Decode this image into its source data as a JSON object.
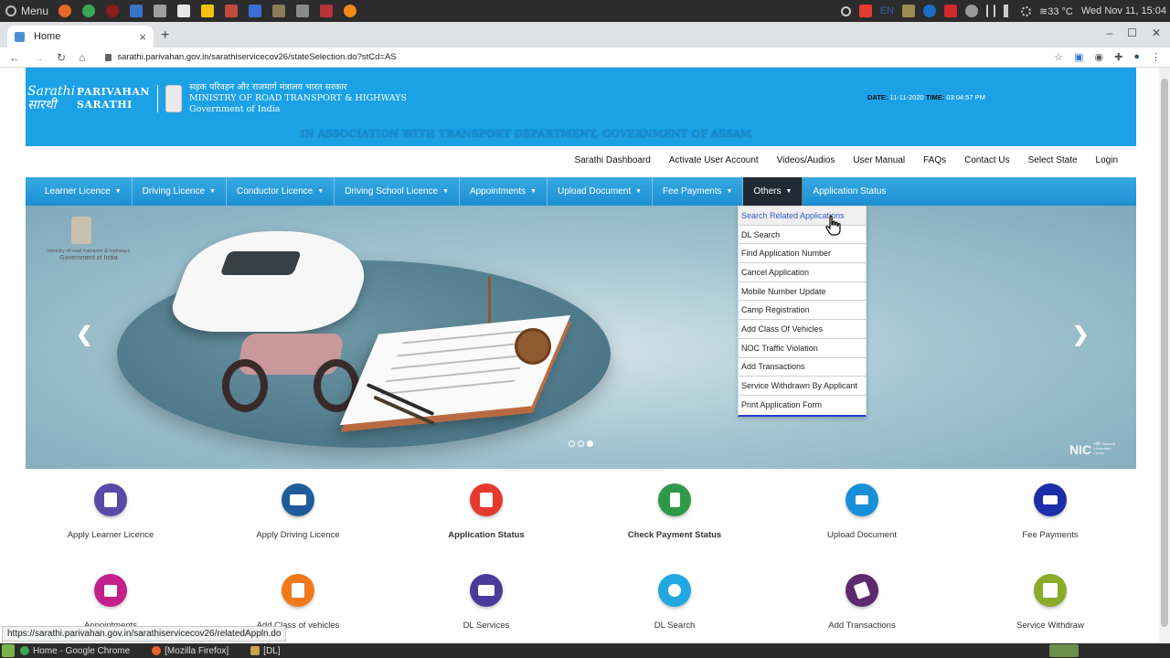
{
  "os": {
    "menu_label": "Menu",
    "temperature": "≋33 °C",
    "clock": "Wed Nov 11, 15:04",
    "tray_lang": "EN"
  },
  "browser": {
    "tab_title": "Home",
    "url": "sarathi.parivahan.gov.in/sarathiservicecov26/stateSelection.do?stCd=AS",
    "status_url": "https://sarathi.parivahan.gov.in/sarathiservicecov26/relatedAppln.do"
  },
  "header": {
    "logo_mark_1": "Sarathi",
    "logo_mark_2": "सारथी",
    "brand_1": "PARIVAHAN",
    "brand_2": "SARATHI",
    "ministry_hindi": "सड़क परिवहन और राजमार्ग मंत्रालय भारत सरकार",
    "ministry_english": "MINISTRY OF ROAD TRANSPORT & HIGHWAYS",
    "government": "Government of India",
    "date_label": "DATE:",
    "date_value": "11-11-2020",
    "time_label": "TIME:",
    "time_value": "03:04:57 PM",
    "association": "IN ASSOCIATION WITH TRANSPORT DEPARTMENT, GOVERNMENT OF ASSAM"
  },
  "top_links": [
    "Sarathi Dashboard",
    "Activate User Account",
    "Videos/Audios",
    "User Manual",
    "FAQs",
    "Contact Us",
    "Select State",
    "Login"
  ],
  "nav": [
    {
      "label": "Learner Licence",
      "caret": "▼"
    },
    {
      "label": "Driving Licence",
      "caret": "▼"
    },
    {
      "label": "Conductor Licence",
      "caret": "▼"
    },
    {
      "label": "Driving School Licence",
      "caret": "▼"
    },
    {
      "label": "Appointments",
      "caret": "▼"
    },
    {
      "label": "Upload Document",
      "caret": "▼"
    },
    {
      "label": "Fee Payments",
      "caret": "▼"
    },
    {
      "label": "Others",
      "caret": "▼"
    },
    {
      "label": "Application Status",
      "caret": ""
    }
  ],
  "others_menu": [
    "Search Related Applications",
    "DL Search",
    "Find Application Number",
    "Cancel Application",
    "Mobile Number Update",
    "Camp Registration",
    "Add Class Of Vehicles",
    "NOC Traffic Violation",
    "Add Transactions",
    "Service Withdrawn By Applicant",
    "Print Application Form"
  ],
  "banner": {
    "emblem_text_1": "ministry of road transport & highways",
    "emblem_text_2": "Government of India",
    "prev": "❮",
    "next": "❯",
    "nic": "NIC",
    "nic_small": "राष्ट्रीय National Informatics Centre"
  },
  "services_row1": [
    {
      "label": "Apply Learner Licence",
      "color": "#5a4aa8",
      "icon": "learner-icon"
    },
    {
      "label": "Apply Driving Licence",
      "color": "#1f5c9a",
      "icon": "license-card-icon"
    },
    {
      "label": "Application Status",
      "color": "#e53a2d",
      "icon": "document-icon"
    },
    {
      "label": "Check Payment Status",
      "color": "#2e9a48",
      "icon": "payment-icon"
    },
    {
      "label": "Upload Document",
      "color": "#1790d8",
      "icon": "upload-icon"
    },
    {
      "label": "Fee Payments",
      "color": "#1d2fa8",
      "icon": "card-hand-icon"
    }
  ],
  "services_row2": [
    {
      "label": "Appointments",
      "color": "#c3208a",
      "icon": "calendar-icon"
    },
    {
      "label": "Add Class of vehicles",
      "color": "#f07a1a",
      "icon": "form-icon"
    },
    {
      "label": "DL Services",
      "color": "#4a3a9a",
      "icon": "id-card-icon"
    },
    {
      "label": "DL Search",
      "color": "#22a8e0",
      "icon": "user-search-icon"
    },
    {
      "label": "Add Transactions",
      "color": "#5e2a6e",
      "icon": "transaction-icon"
    },
    {
      "label": "Service Withdraw",
      "color": "#8aab2a",
      "icon": "withdraw-icon"
    }
  ],
  "taskbar": [
    {
      "label": "Home - Google Chrome"
    },
    {
      "label": "[Mozilla Firefox]"
    },
    {
      "label": "[DL]"
    }
  ]
}
